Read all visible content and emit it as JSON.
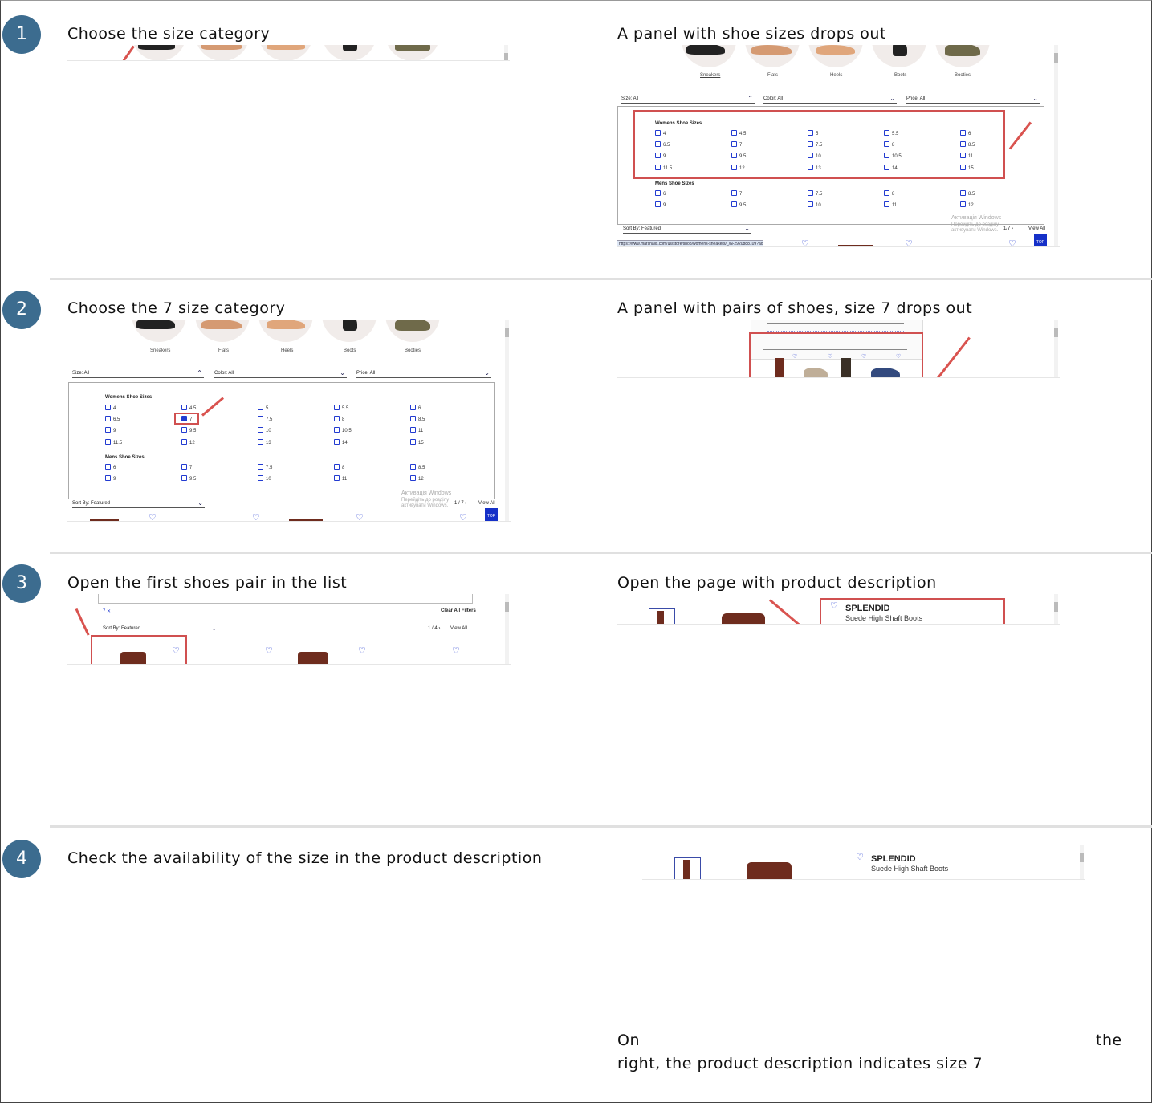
{
  "steps": [
    {
      "number": "1",
      "left_caption": "Choose the size category",
      "right_caption": "A panel with shoe sizes drops out"
    },
    {
      "number": "2",
      "left_caption": "Choose the 7 size category",
      "right_caption": "A panel with pairs of shoes, size 7 drops out"
    },
    {
      "number": "3",
      "left_caption": "Open the first shoes pair in the list",
      "right_caption": "Open the page with product description"
    },
    {
      "number": "4",
      "left_caption": "Check the availability of the size in the product description",
      "right_caption_line1_start": "On",
      "right_caption_line1_end": "the",
      "right_caption_line2": "right, the product description indicates size 7"
    }
  ],
  "store": {
    "categories": [
      "Sneakers",
      "Flats",
      "Heels",
      "Boots",
      "Booties"
    ],
    "filters": {
      "size": "Size: All",
      "color": "Color: All",
      "price": "Price: All"
    },
    "womens_title": "Womens Shoe Sizes",
    "womens_sizes": [
      "4",
      "4.5",
      "5",
      "5.5",
      "6",
      "6.5",
      "7",
      "7.5",
      "8",
      "8.5",
      "9",
      "9.5",
      "10",
      "10.5",
      "11",
      "11.5",
      "12",
      "13",
      "14",
      "15"
    ],
    "mens_title": "Mens Shoe Sizes",
    "mens_sizes": [
      "6",
      "7",
      "7.5",
      "8",
      "8.5",
      "9",
      "9.5",
      "10",
      "11",
      "12"
    ],
    "sort": "Sort By: Featured",
    "pager": "1 / 7",
    "pager_short": "1/7",
    "pager_results": "1 / 4",
    "view_all": "View All",
    "top": "TOP",
    "watermark_line1": "Активація Windows",
    "watermark_line2": "Перейдіть до розділу",
    "watermark_line3": "активувати Windows.",
    "url": "https://www.marshalls.com/us/store/shop/womens-sneakers/_/N-2920888109?ao...",
    "active_filter": "7",
    "clear_filters": "Clear All Filters",
    "brand": "SPLENDID",
    "product_name": "Suede High Shaft Boots"
  }
}
